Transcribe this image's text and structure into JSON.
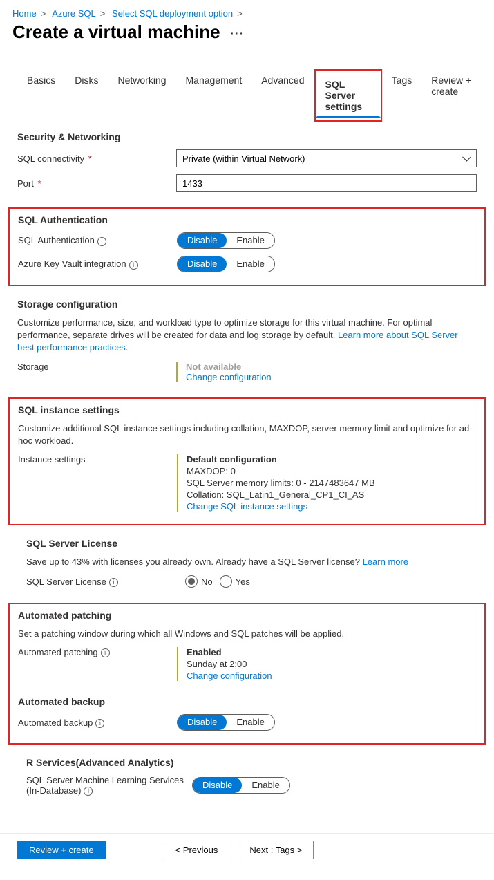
{
  "breadcrumb": [
    "Home",
    "Azure SQL",
    "Select SQL deployment option"
  ],
  "page_title": "Create a virtual machine",
  "tabs": [
    "Basics",
    "Disks",
    "Networking",
    "Management",
    "Advanced",
    "SQL Server settings",
    "Tags",
    "Review + create"
  ],
  "security": {
    "title": "Security & Networking",
    "connectivity_label": "SQL connectivity",
    "connectivity_value": "Private (within Virtual Network)",
    "port_label": "Port",
    "port_value": "1433"
  },
  "auth": {
    "title": "SQL Authentication",
    "sql_auth_label": "SQL Authentication",
    "akv_label": "Azure Key Vault integration",
    "disable": "Disable",
    "enable": "Enable"
  },
  "storage": {
    "title": "Storage configuration",
    "desc": "Customize performance, size, and workload type to optimize storage for this virtual machine. For optimal performance, separate drives will be created for data and log storage by default. ",
    "link": "Learn more about SQL Server best performance practices.",
    "label": "Storage",
    "value": "Not available",
    "change": "Change configuration"
  },
  "instance": {
    "title": "SQL instance settings",
    "desc": "Customize additional SQL instance settings including collation, MAXDOP, server memory limit and optimize for ad-hoc workload.",
    "label": "Instance settings",
    "value_title": "Default configuration",
    "maxdop": "MAXDOP: 0",
    "memory": "SQL Server memory limits: 0 - 2147483647 MB",
    "collation": "Collation: SQL_Latin1_General_CP1_CI_AS",
    "change": "Change SQL instance settings"
  },
  "license": {
    "title": "SQL Server License",
    "desc": "Save up to 43% with licenses you already own. Already have a SQL Server license? ",
    "learn": "Learn more",
    "label": "SQL Server License",
    "no": "No",
    "yes": "Yes"
  },
  "autopatch": {
    "title": "Automated patching",
    "desc": "Set a patching window during which all Windows and SQL patches will be applied.",
    "label": "Automated patching",
    "value_title": "Enabled",
    "schedule": "Sunday at 2:00",
    "change": "Change configuration"
  },
  "autobackup": {
    "title": "Automated backup",
    "label": "Automated backup",
    "disable": "Disable",
    "enable": "Enable"
  },
  "rservices": {
    "title": "R Services(Advanced Analytics)",
    "label": "SQL Server Machine Learning Services (In-Database)",
    "disable": "Disable",
    "enable": "Enable"
  },
  "footer": {
    "review": "Review + create",
    "prev": "< Previous",
    "next": "Next : Tags >"
  }
}
